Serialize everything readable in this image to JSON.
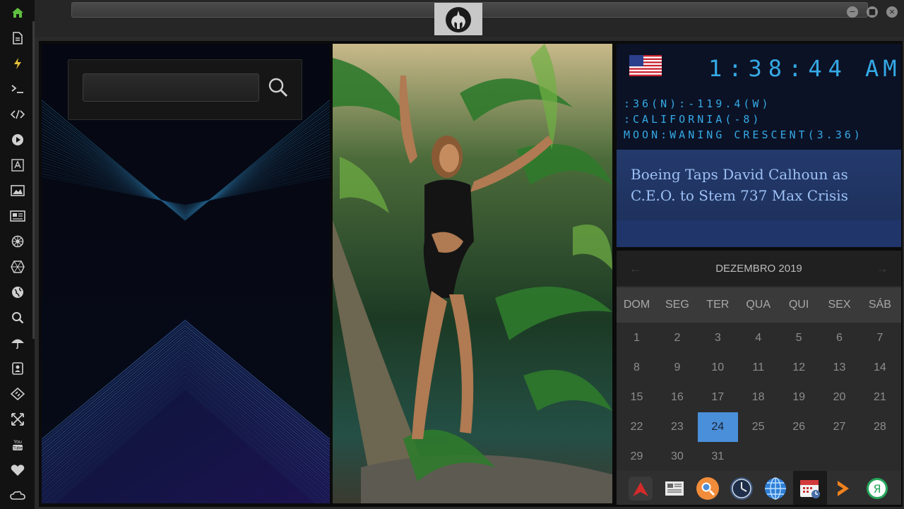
{
  "sidebar": {
    "items": [
      {
        "icon": "home-icon"
      },
      {
        "icon": "document-icon"
      },
      {
        "icon": "bolt-icon"
      },
      {
        "icon": "terminal-icon"
      },
      {
        "icon": "code-icon"
      },
      {
        "icon": "play-icon"
      },
      {
        "icon": "translate-icon"
      },
      {
        "icon": "image-icon"
      },
      {
        "icon": "news-icon"
      },
      {
        "icon": "settings-wheel-icon"
      },
      {
        "icon": "hexagon-icon"
      },
      {
        "icon": "globe-icon"
      },
      {
        "icon": "search-icon"
      },
      {
        "icon": "umbrella-icon"
      },
      {
        "icon": "contacts-icon"
      },
      {
        "icon": "diamond-code-icon"
      },
      {
        "icon": "expand-icon"
      },
      {
        "icon": "youtube-icon"
      },
      {
        "icon": "heart-icon"
      },
      {
        "icon": "cloud-icon"
      }
    ],
    "youtube_label": "You Tube"
  },
  "window": {
    "minimize": "−",
    "maximize": "■",
    "close": "×"
  },
  "search": {
    "value": "",
    "placeholder": ""
  },
  "clock": {
    "time": "1:38:44",
    "ampm": "AM",
    "coords": ":36(N):-119.4(W)",
    "timezone": ":CALIFORNIA(-8)",
    "moon": "MOON:WANING CRESCENT(3.36)"
  },
  "news": {
    "headline": "Boeing Taps David Calhoun as C.E.O. to Stem 737 Max Crisis"
  },
  "calendar": {
    "month_year": "DEZEMBRO 2019",
    "prev": "←",
    "next": "→",
    "weekdays": [
      "DOM",
      "SEG",
      "TER",
      "QUA",
      "QUI",
      "SEX",
      "SÁB"
    ],
    "days": [
      "1",
      "2",
      "3",
      "4",
      "5",
      "6",
      "7",
      "8",
      "9",
      "10",
      "11",
      "12",
      "13",
      "14",
      "15",
      "16",
      "17",
      "18",
      "19",
      "20",
      "21",
      "22",
      "23",
      "24",
      "25",
      "26",
      "27",
      "28",
      "29",
      "30",
      "31"
    ],
    "first_weekday_index": 0,
    "today": "24"
  },
  "dock": {
    "items": [
      "arrow-up-app-icon",
      "newspaper-app-icon",
      "search-app-icon",
      "clock-app-icon",
      "globe-app-icon",
      "calendar-app-icon",
      "terminal-app-icon",
      "yandex-app-icon"
    ]
  },
  "colors": {
    "accent": "#35a9e6",
    "today": "#4a8fd9",
    "active_sidebar": "#5fbf3f",
    "bolt": "#e7c13a"
  }
}
